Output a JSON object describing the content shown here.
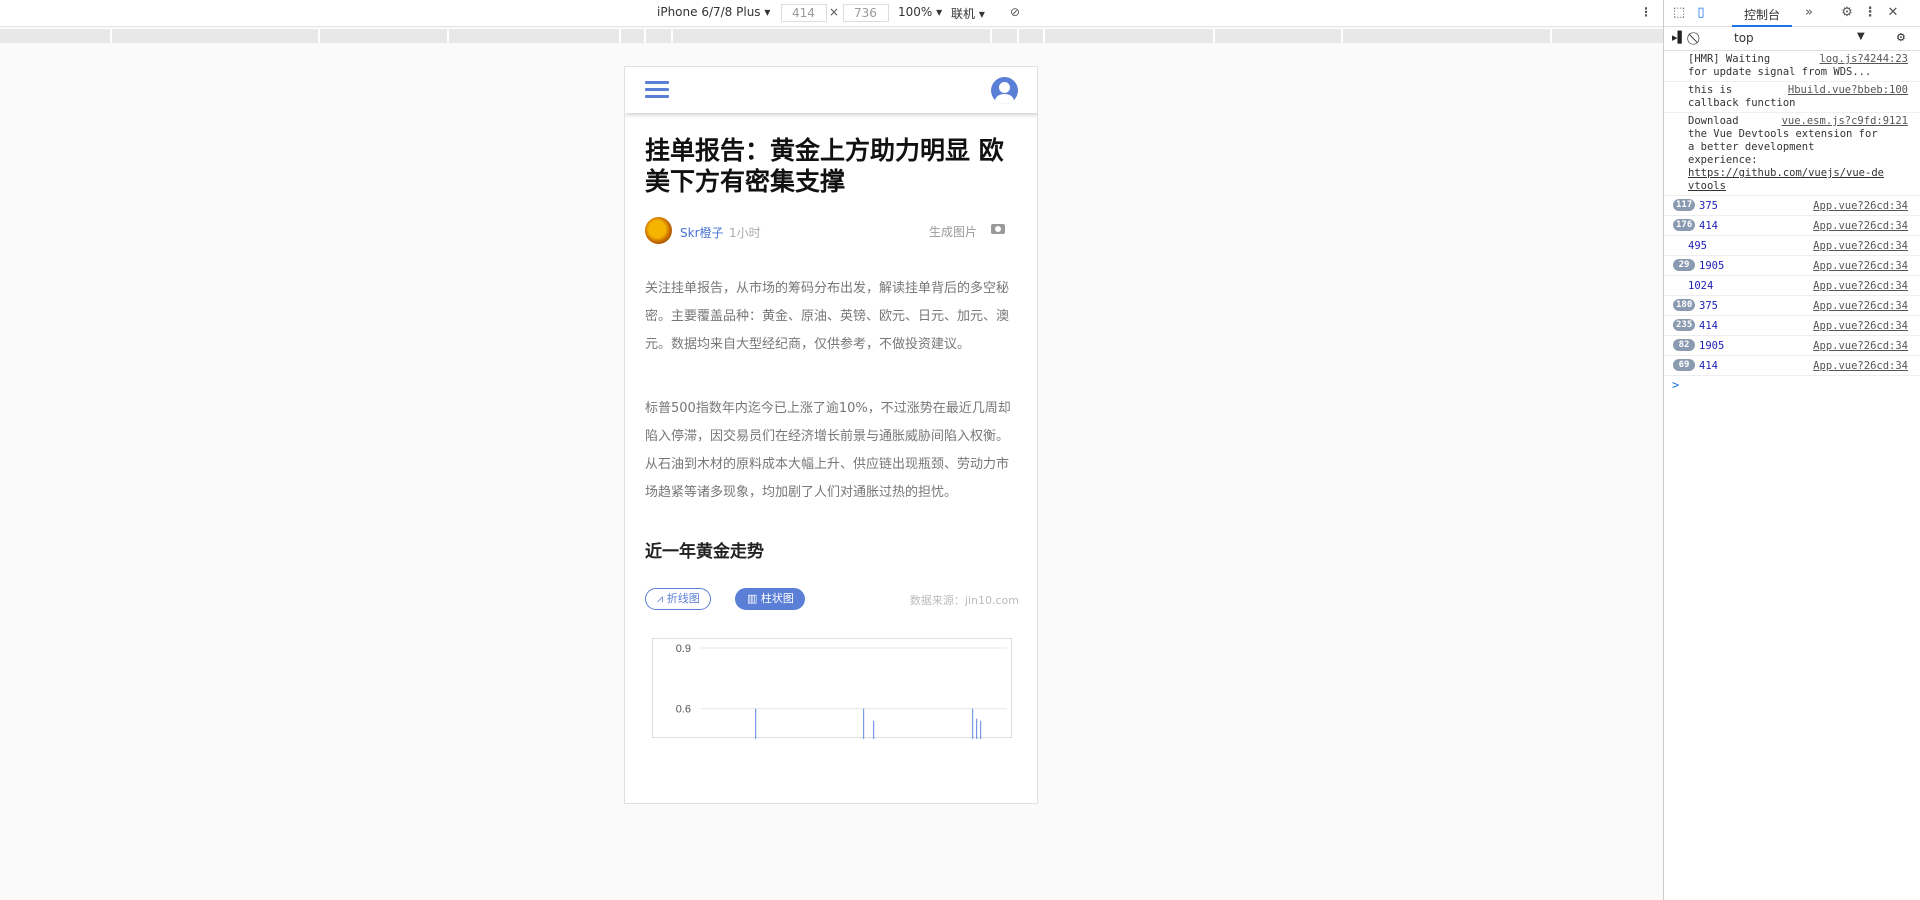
{
  "emulator_toolbar": {
    "device": "iPhone 6/7/8 Plus",
    "width": "414",
    "height": "736",
    "zoom": "100%",
    "network": "联机"
  },
  "phone": {
    "article": {
      "title": "挂单报告：黄金上方助力明显 欧美下方有密集支撑",
      "author": "Skr橙子",
      "ago": "1小时",
      "generate_image": "生成图片",
      "paragraphs": [
        "关注挂单报告，从市场的筹码分布出发，解读挂单背后的多空秘密。主要覆盖品种：黄金、原油、英镑、欧元、日元、加元、澳元。数据均来自大型经纪商，仅供参考，不做投资建议。",
        "标普500指数年内迄今已上涨了逾10%，不过涨势在最近几周却陷入停滞，因交易员们在经济增长前景与通胀威胁间陷入权衡。从石油到木材的原料成本大幅上升、供应链出现瓶颈、劳动力市场趋紧等诸多现象，均加剧了人们对通胀过热的担忧。"
      ],
      "section_title": "近一年黄金走势",
      "tab_line": "折线图",
      "tab_bar": "柱状图",
      "source": "数据来源：jin10.com"
    }
  },
  "chart_data": {
    "type": "bar",
    "y_ticks": [
      "0.9",
      "0.6"
    ],
    "ylim": [
      0.45,
      0.9
    ],
    "values": [
      0.6,
      0.6,
      0.54,
      0.6,
      0.55,
      0.54
    ]
  },
  "devtools": {
    "tab": "控制台",
    "context": "top",
    "logs": [
      {
        "msg": "[HMR] Waiting\nfor update signal from WDS...",
        "src": "log.js?4244:23"
      },
      {
        "msg": "this is\ncallback function",
        "src": "Hbuild.vue?bbeb:100"
      },
      {
        "msg": "Download\nthe Vue Devtools extension for\na better development\nexperience:",
        "link": "https://github.com/vuejs/vue-de\nvtools",
        "src": "vue.esm.js?c9fd:9121"
      }
    ],
    "numeric_logs": [
      {
        "badge": "117",
        "value": "375",
        "src": "App.vue?26cd:34"
      },
      {
        "badge": "176",
        "value": "414",
        "src": "App.vue?26cd:34"
      },
      {
        "badge": "",
        "value": "495",
        "src": "App.vue?26cd:34"
      },
      {
        "badge": "29",
        "value": "1905",
        "src": "App.vue?26cd:34"
      },
      {
        "badge": "",
        "value": "1024",
        "src": "App.vue?26cd:34"
      },
      {
        "badge": "180",
        "value": "375",
        "src": "App.vue?26cd:34"
      },
      {
        "badge": "235",
        "value": "414",
        "src": "App.vue?26cd:34"
      },
      {
        "badge": "82",
        "value": "1905",
        "src": "App.vue?26cd:34"
      },
      {
        "badge": "69",
        "value": "414",
        "src": "App.vue?26cd:34"
      }
    ],
    "prompt": ">"
  },
  "colors": {
    "accent": "#5b7fd6",
    "link": "#4a73d6"
  }
}
